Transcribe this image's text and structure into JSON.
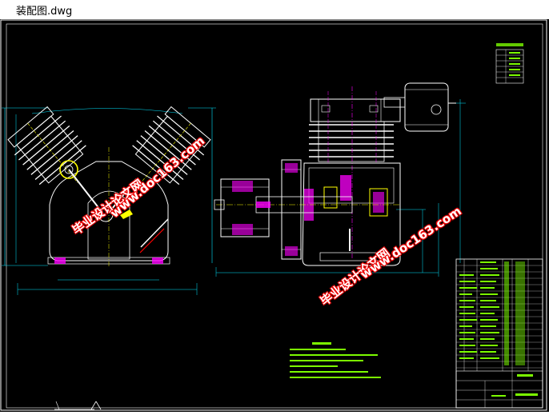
{
  "window": {
    "title": "装配图.dwg"
  },
  "watermarks": [
    {
      "text": "毕业设计论文网"
    },
    {
      "text": "www.doc163.com"
    },
    {
      "text": "毕业设计论文网"
    },
    {
      "text": "www.doc163.com"
    }
  ],
  "colors": {
    "background": "#000000",
    "outline": "#ffffff",
    "dimension": "#00e5ff",
    "text": "#7cfc00",
    "accent": "#ff00ff",
    "yellow": "#ffff00",
    "watermark_fill": "#ffffff",
    "watermark_outline": "#e00000"
  },
  "icons": [
    "ucs-axis-icon"
  ]
}
